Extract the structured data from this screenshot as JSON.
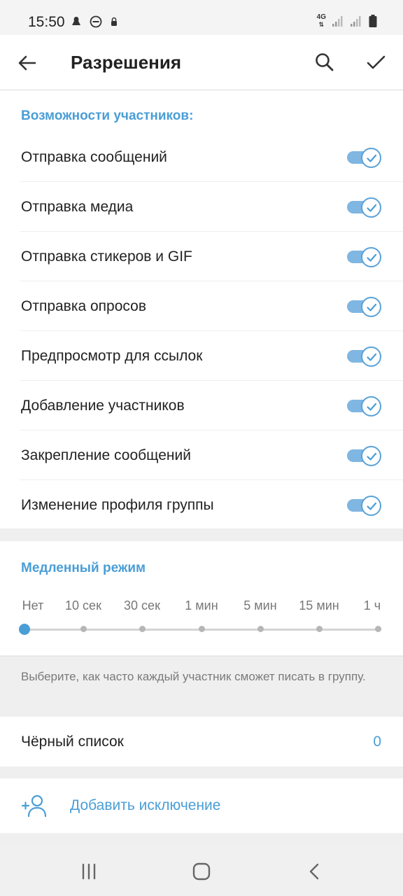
{
  "status_bar": {
    "time": "15:50",
    "network": "4G",
    "icons_left": [
      "notification-icon",
      "dnd-icon",
      "lock-icon"
    ],
    "icons_right": [
      "signal-icon",
      "signal-icon",
      "battery-icon"
    ]
  },
  "app_bar": {
    "title": "Разрешения",
    "back_icon": "arrow-left-icon",
    "search_icon": "search-icon",
    "done_icon": "check-icon"
  },
  "permissions": {
    "header": "Возможности участников:",
    "items": [
      {
        "label": "Отправка сообщений",
        "enabled": true
      },
      {
        "label": "Отправка медиа",
        "enabled": true
      },
      {
        "label": "Отправка стикеров и GIF",
        "enabled": true
      },
      {
        "label": "Отправка опросов",
        "enabled": true
      },
      {
        "label": "Предпросмотр для ссылок",
        "enabled": true
      },
      {
        "label": "Добавление участников",
        "enabled": true
      },
      {
        "label": "Закрепление сообщений",
        "enabled": true
      },
      {
        "label": "Изменение профиля группы",
        "enabled": true
      }
    ]
  },
  "slow_mode": {
    "header": "Медленный режим",
    "options": [
      "Нет",
      "10 сек",
      "30 сек",
      "1 мин",
      "5 мин",
      "15 мин",
      "1 ч"
    ],
    "selected": "Нет",
    "hint": "Выберите, как часто каждый участник сможет писать в группу."
  },
  "blacklist": {
    "label": "Чёрный список",
    "count": "0"
  },
  "add_exception": {
    "label": "Добавить исключение",
    "icon": "add-user-icon"
  },
  "colors": {
    "accent": "#4a9ed6",
    "toggle_track": "#7fb6e2",
    "background": "#efeff0"
  },
  "nav_bar": {
    "icons": [
      "recent-apps-icon",
      "home-icon",
      "back-icon"
    ]
  }
}
